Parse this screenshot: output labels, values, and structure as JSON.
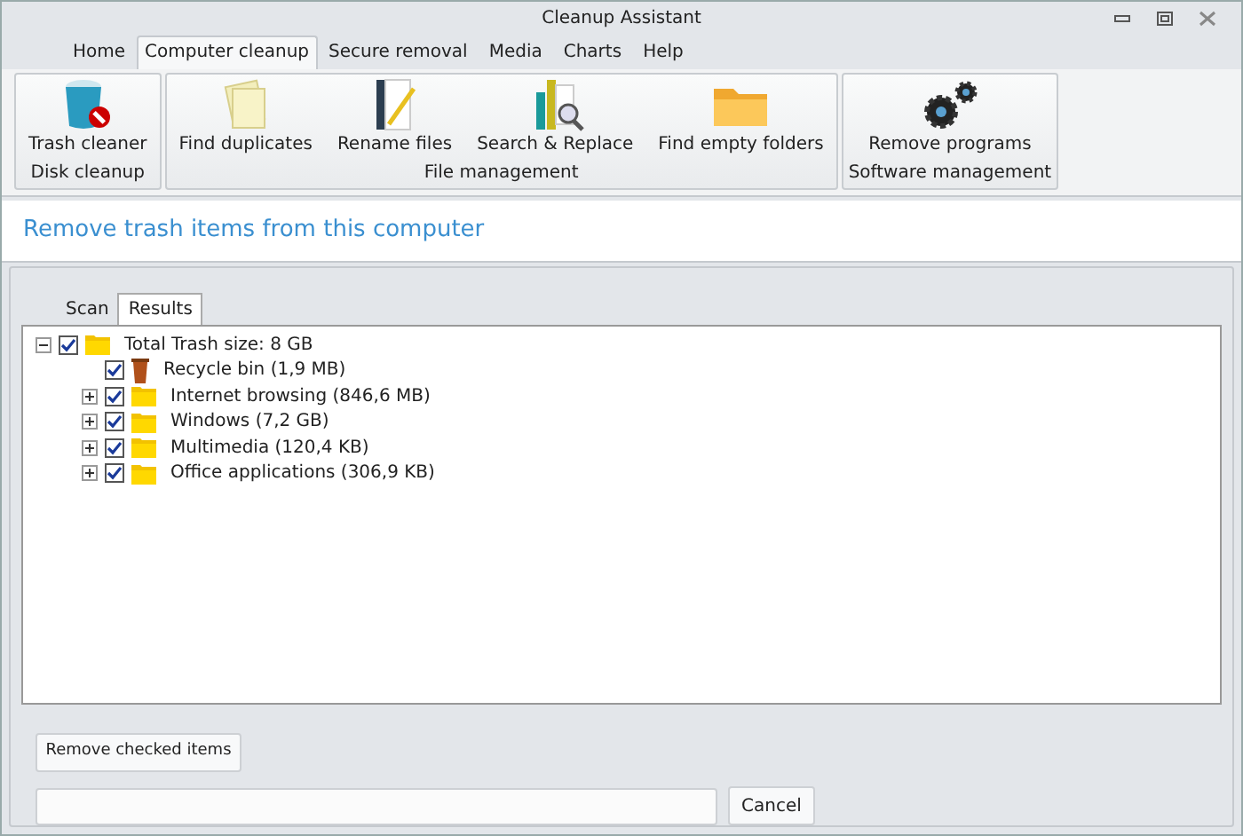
{
  "window": {
    "title": "Cleanup Assistant"
  },
  "menu_tabs": [
    {
      "label": "Home",
      "selected": false
    },
    {
      "label": "Computer cleanup",
      "selected": true
    },
    {
      "label": "Secure removal",
      "selected": false
    },
    {
      "label": "Media",
      "selected": false
    },
    {
      "label": "Charts",
      "selected": false
    },
    {
      "label": "Help",
      "selected": false
    }
  ],
  "ribbon_groups": [
    {
      "label": "Disk cleanup",
      "buttons": [
        {
          "label": "Trash cleaner",
          "kind": "trash"
        }
      ]
    },
    {
      "label": "File management",
      "buttons": [
        {
          "label": "Find duplicates",
          "kind": "papers"
        },
        {
          "label": "Rename files",
          "kind": "rename"
        },
        {
          "label": "Search & Replace",
          "kind": "search"
        },
        {
          "label": "Find empty folders",
          "kind": "folder"
        }
      ]
    },
    {
      "label": "Software management",
      "buttons": [
        {
          "label": "Remove programs",
          "kind": "gears"
        }
      ]
    }
  ],
  "heading": "Remove trash items from this computer",
  "view_tabs": [
    {
      "label": "Scan",
      "selected": false
    },
    {
      "label": "Results",
      "selected": true
    }
  ],
  "tree": [
    {
      "label": "Total Trash size: 8 GB",
      "kind": "folder",
      "checked": true,
      "expanded": true,
      "children": [
        {
          "label": "Recycle bin (1,9 MB)",
          "kind": "bin",
          "checked": true
        },
        {
          "label": "Internet browsing (846,6 MB)",
          "kind": "folder",
          "checked": true,
          "expanded": false
        },
        {
          "label": "Windows (7,2 GB)",
          "kind": "folder",
          "checked": true,
          "expanded": false
        },
        {
          "label": "Multimedia (120,4 KB)",
          "kind": "folder",
          "checked": true,
          "expanded": false
        },
        {
          "label": "Office applications (306,9 KB)",
          "kind": "folder",
          "checked": true,
          "expanded": false
        }
      ]
    }
  ],
  "progress": {
    "level": 0
  },
  "buttons": {
    "remove": "Remove checked items",
    "cancel": "Cancel"
  }
}
